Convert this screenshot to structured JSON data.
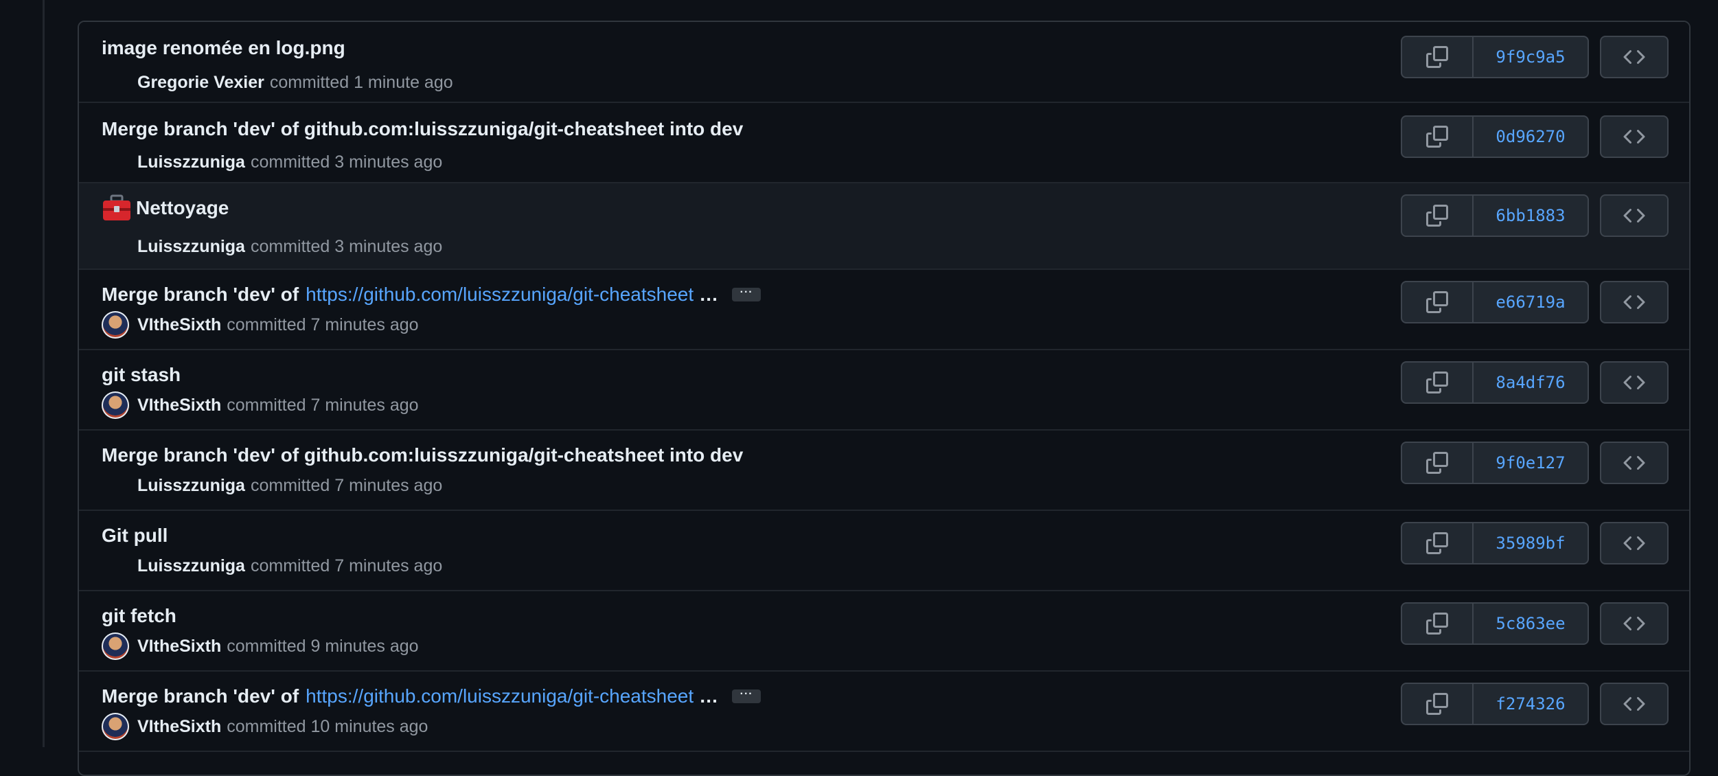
{
  "commits": [
    {
      "title": "image renomée en log.png",
      "author": "Gregorie Vexier",
      "time_text": "committed 1 minute ago",
      "sha": "9f9c9a5"
    },
    {
      "title": "Merge branch 'dev' of github.com:luisszzuniga/git-cheatsheet into dev",
      "author": "Luisszzuniga",
      "time_text": "committed 3 minutes ago",
      "sha": "0d96270"
    },
    {
      "title": "Nettoyage",
      "author": "Luisszzuniga",
      "time_text": "committed 3 minutes ago",
      "sha": "6bb1883",
      "emoji_icon": "toolbox-icon"
    },
    {
      "title_prefix": "Merge branch 'dev' of",
      "title_link": "https://github.com/luisszzuniga/git-cheatsheet",
      "title_suffix": "…",
      "expand_label": "···",
      "author": "VItheSixth",
      "time_text": "committed 7 minutes ago",
      "sha": "e66719a"
    },
    {
      "title": "git stash",
      "author": "VItheSixth",
      "time_text": "committed 7 minutes ago",
      "sha": "8a4df76"
    },
    {
      "title": "Merge branch 'dev' of github.com:luisszzuniga/git-cheatsheet into dev",
      "author": "Luisszzuniga",
      "time_text": "committed 7 minutes ago",
      "sha": "9f0e127"
    },
    {
      "title": "Git pull",
      "author": "Luisszzuniga",
      "time_text": "committed 7 minutes ago",
      "sha": "35989bf"
    },
    {
      "title": "git fetch",
      "author": "VItheSixth",
      "time_text": "committed 9 minutes ago",
      "sha": "5c863ee"
    },
    {
      "title_prefix": "Merge branch 'dev' of",
      "title_link": "https://github.com/luisszzuniga/git-cheatsheet",
      "title_suffix": "…",
      "expand_label": "···",
      "author": "VItheSixth",
      "time_text": "committed 10 minutes ago",
      "sha": "f274326"
    }
  ],
  "icons": {
    "copy": "copy-icon",
    "browse": "code-icon",
    "avatar": "avatar"
  },
  "colors": {
    "background": "#0d1117",
    "link": "#58a6ff",
    "text": "#e6edf3",
    "muted": "#9198a1",
    "border": "#30363d"
  }
}
